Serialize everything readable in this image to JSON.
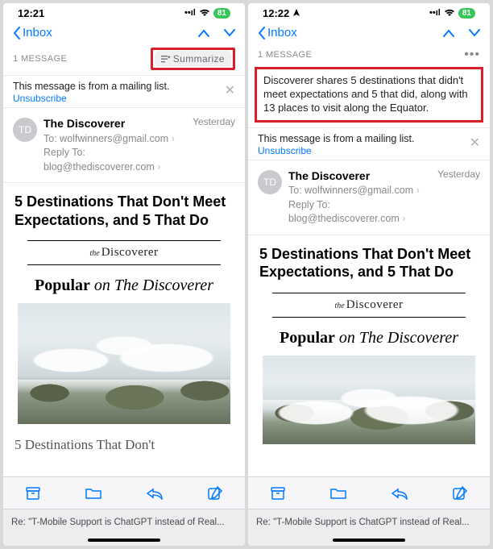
{
  "left": {
    "status": {
      "time": "12:21",
      "battery": "81"
    },
    "nav": {
      "back": "Inbox"
    },
    "msgbar": {
      "count": "1 MESSAGE",
      "summarize": "Summarize"
    },
    "mlist": {
      "txt": "This message is from a mailing list.",
      "unsub": "Unsubscribe"
    },
    "sender": {
      "initials": "TD",
      "name": "The Discoverer",
      "to_label": "To:",
      "to_value": "wolfwinners@gmail.com",
      "reply_label": "Reply To:",
      "reply_value": "blog@thediscoverer.com",
      "date": "Yesterday"
    },
    "headline": "5 Destinations That Don't Meet Expectations, and 5 That Do",
    "brand": {
      "the": "the",
      "name": "Discoverer"
    },
    "popular": {
      "a": "Popular",
      "b": " on The Discoverer"
    },
    "subhead": "5 Destinations That Don't",
    "tab": "Re: \"T-Mobile Support is ChatGPT instead of Real..."
  },
  "right": {
    "status": {
      "time": "12:22",
      "battery": "81"
    },
    "nav": {
      "back": "Inbox"
    },
    "msgbar": {
      "count": "1 MESSAGE"
    },
    "summary": "Discoverer shares 5 destinations that didn't meet expectations and 5 that did, along with 13 places to visit along the Equator.",
    "mlist": {
      "txt": "This message is from a mailing list.",
      "unsub": "Unsubscribe"
    },
    "sender": {
      "initials": "TD",
      "name": "The Discoverer",
      "to_label": "To:",
      "to_value": "wolfwinners@gmail.com",
      "reply_label": "Reply To:",
      "reply_value": "blog@thediscoverer.com",
      "date": "Yesterday"
    },
    "headline": "5 Destinations That Don't Meet Expectations, and 5 That Do",
    "brand": {
      "the": "the",
      "name": "Discoverer"
    },
    "popular": {
      "a": "Popular",
      "b": " on The Discoverer"
    },
    "tab": "Re: \"T-Mobile Support is ChatGPT instead of Real..."
  }
}
